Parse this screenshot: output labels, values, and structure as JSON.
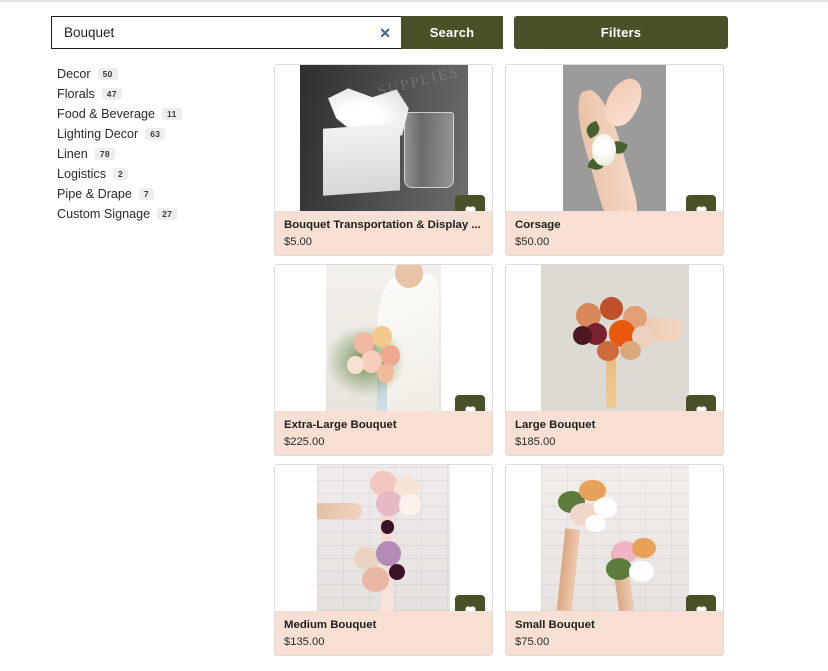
{
  "search": {
    "value": "Bouquet",
    "placeholder": "Search",
    "clear_icon": "close-x-icon",
    "search_label": "Search",
    "filters_label": "Filters"
  },
  "sidebar": {
    "categories": [
      {
        "label": "Decor",
        "count": "50"
      },
      {
        "label": "Florals",
        "count": "47"
      },
      {
        "label": "Food & Beverage",
        "count": "11"
      },
      {
        "label": "Lighting Decor",
        "count": "63"
      },
      {
        "label": "Linen",
        "count": "78"
      },
      {
        "label": "Logistics",
        "count": "2"
      },
      {
        "label": "Pipe & Drape",
        "count": "7"
      },
      {
        "label": "Custom Signage",
        "count": "27"
      }
    ]
  },
  "products": [
    {
      "title": "Bouquet Transportation & Display ...",
      "price": "$5.00",
      "favorite_icon": "heart-icon"
    },
    {
      "title": "Corsage",
      "price": "$50.00",
      "favorite_icon": "heart-icon"
    },
    {
      "title": "Extra-Large Bouquet",
      "price": "$225.00",
      "favorite_icon": "heart-icon"
    },
    {
      "title": "Large Bouquet",
      "price": "$185.00",
      "favorite_icon": "heart-icon"
    },
    {
      "title": "Medium Bouquet",
      "price": "$135.00",
      "favorite_icon": "heart-icon"
    },
    {
      "title": "Small Bouquet",
      "price": "$75.00",
      "favorite_icon": "heart-icon"
    }
  ],
  "watermark": {
    "text": "SUPPLIES"
  },
  "colors": {
    "accent_green": "#4a5128",
    "info_bar_peach": "#f7e0d3",
    "badge_gray": "#ededed",
    "clear_blue": "#3c6099"
  }
}
